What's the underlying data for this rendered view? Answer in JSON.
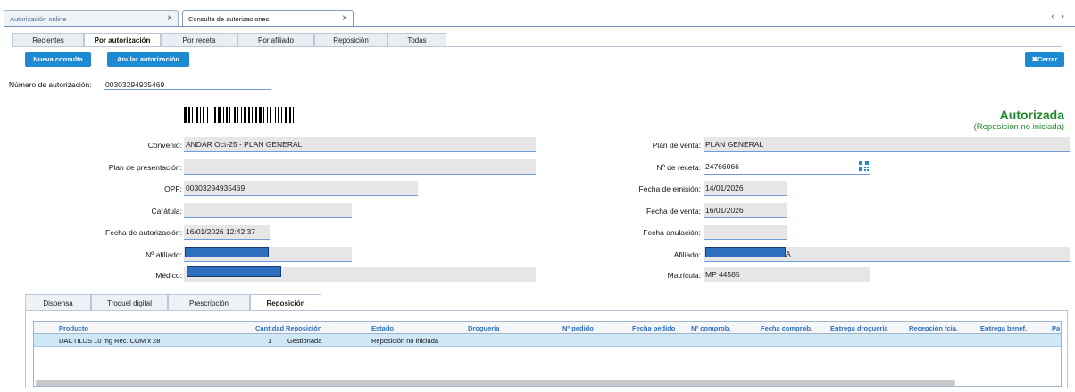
{
  "doc_tabs": [
    "Autorización online",
    "Consulta de autorizaciones"
  ],
  "close_glyph": "×",
  "nav": {
    "prev": "‹",
    "next": "›"
  },
  "sub_tabs": [
    "Recientes",
    "Por autorización",
    "Por receta",
    "Por afiliado",
    "Reposición",
    "Todas"
  ],
  "buttons": {
    "nueva": "Nueva consulta",
    "anular": "Anular autorización",
    "cerrar": "✖Cerrar"
  },
  "auth_number": {
    "label": "Número de autorización:",
    "value": "00303294935469"
  },
  "status": {
    "title": "Autorizada",
    "subtitle": "(Reposición no iniciada)"
  },
  "fields_left": {
    "convenio": {
      "label": "Convenio:",
      "value": "ANDAR Oct-25 - PLAN GENERAL"
    },
    "plan_presentacion": {
      "label": "Plan de presentación:",
      "value": ""
    },
    "opf": {
      "label": "OPF:",
      "value": "00303294935469"
    },
    "caratula": {
      "label": "Carátula:",
      "value": ""
    },
    "fecha_autorizacion": {
      "label": "Fecha de autorización:",
      "value": "16/01/2026 12:42:37"
    },
    "nro_afiliado": {
      "label": "Nº afiliado:",
      "value": ""
    },
    "medico": {
      "label": "Médico:",
      "value": ""
    }
  },
  "fields_right": {
    "plan_venta": {
      "label": "Plan de venta:",
      "value": "PLAN GENERAL"
    },
    "nro_receta": {
      "label": "Nº de receta:",
      "value": "24766066"
    },
    "fecha_emision": {
      "label": "Fecha de emisión:",
      "value": "14/01/2026"
    },
    "fecha_venta": {
      "label": "Fecha de venta:",
      "value": "16/01/2026"
    },
    "fecha_anulacion": {
      "label": "Fecha anulación:",
      "value": ""
    },
    "afiliado": {
      "label": "Afiliado:",
      "value": "A"
    },
    "matricula": {
      "label": "Matrícula:",
      "value": "MP 44585"
    }
  },
  "bottom_tabs": [
    "Dispensa",
    "Troquel digital",
    "Prescripción",
    "Reposición"
  ],
  "grid": {
    "headers": [
      "Producto",
      "Cantidad",
      "Reposición",
      "Estado",
      "Droguería",
      "Nº pedido",
      "Fecha pedido",
      "Nº comprob.",
      "Fecha comprob.",
      "Entrega droguería",
      "Recepción fcia.",
      "Entrega benef.",
      "Pa"
    ],
    "rows": [
      {
        "producto": "DACTILUS 10 mg Rec. COM x 28",
        "cantidad": "1",
        "reposicion": "Gestionada",
        "estado": "Reposición no iniciada"
      }
    ]
  },
  "colors": {
    "accent": "#1d8ad2",
    "status_green": "#1f8a2a",
    "header_text": "#2e6fc0",
    "selected_row": "#cfe8f6"
  },
  "icons": [
    "close-icon",
    "qr-code-icon",
    "barcode-image"
  ]
}
